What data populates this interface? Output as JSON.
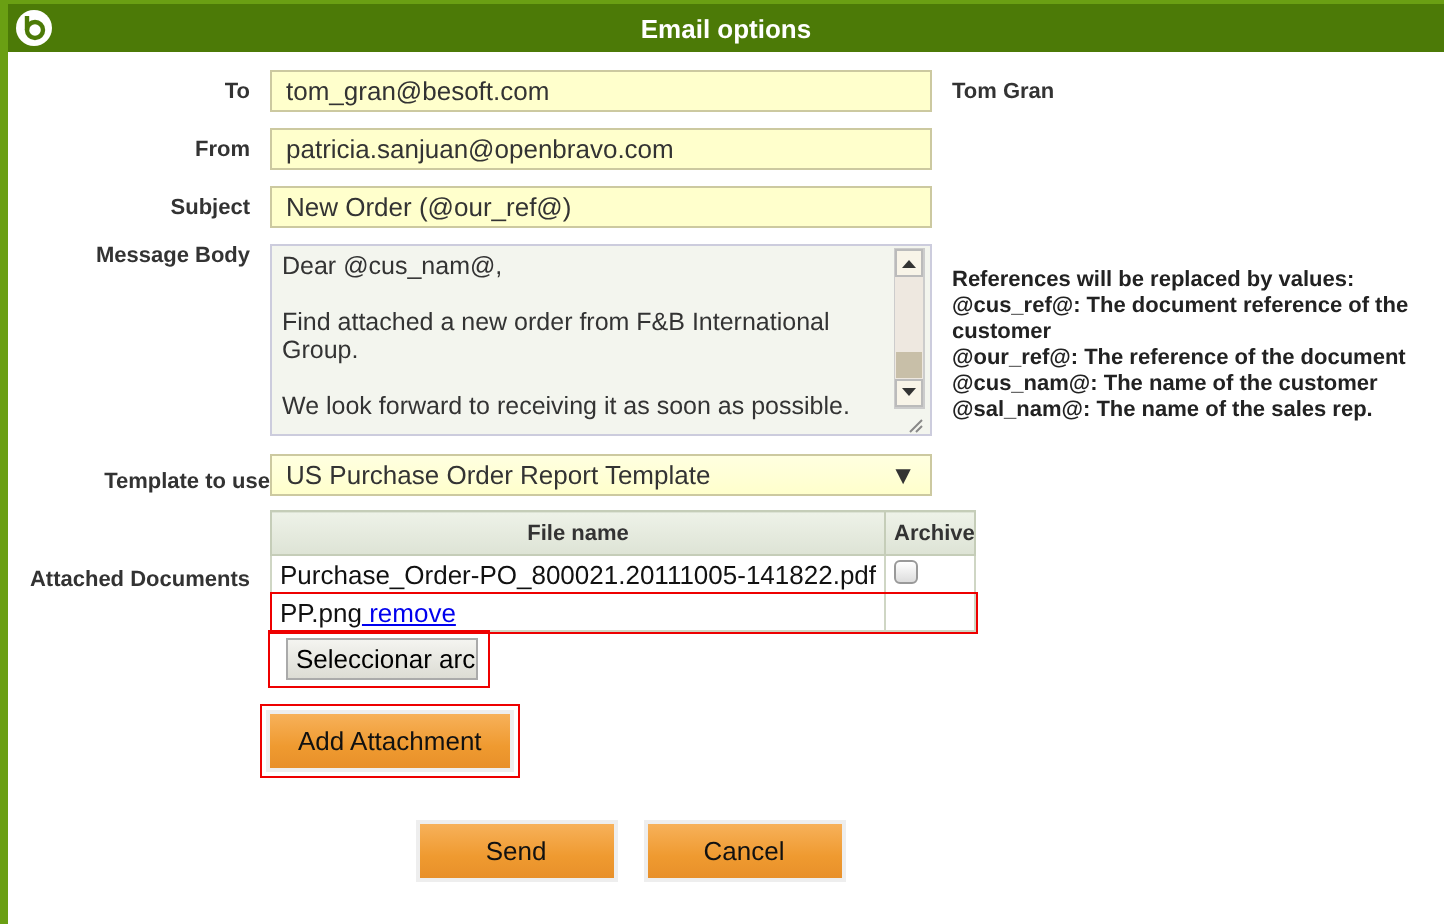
{
  "window": {
    "title": "Email options"
  },
  "fields": [
    {
      "label": "To",
      "value": "tom_gran@besoft.com",
      "note": "Tom Gran"
    },
    {
      "label": "From",
      "value": "patricia.sanjuan@openbravo.com"
    },
    {
      "label": "Subject",
      "value": "New Order (@our_ref@)"
    }
  ],
  "message_body": {
    "label": "Message Body",
    "value": "Dear @cus_nam@,\n\nFind attached a new order from F&B International Group.\n\nWe look forward to receiving it as soon as possible."
  },
  "references": {
    "title": "References will be replaced by values:",
    "items": [
      "@cus_ref@: The document reference of the customer",
      "@our_ref@: The reference of the document",
      "@cus_nam@: The name of the customer",
      "@sal_nam@: The name of the sales rep."
    ]
  },
  "template": {
    "label": "Template to use",
    "value": "US Purchase Order Report Template",
    "arrow": "▼"
  },
  "attachments": {
    "label": "Attached Documents",
    "columns": [
      "File name",
      "Archive"
    ],
    "rows": [
      {
        "kind": "file",
        "name": "Purchase_Order-PO_800021.20111005-141822.pdf",
        "checked": false,
        "highlighted": false
      },
      {
        "kind": "new",
        "name": "PP.png",
        "link": " remove",
        "highlighted": true
      }
    ],
    "file_button": {
      "label": "Seleccionar arc",
      "highlighted": true
    },
    "add_button": {
      "label": "Add Attachment",
      "highlighted": true
    }
  },
  "buttons": [
    "Send",
    "Cancel"
  ]
}
